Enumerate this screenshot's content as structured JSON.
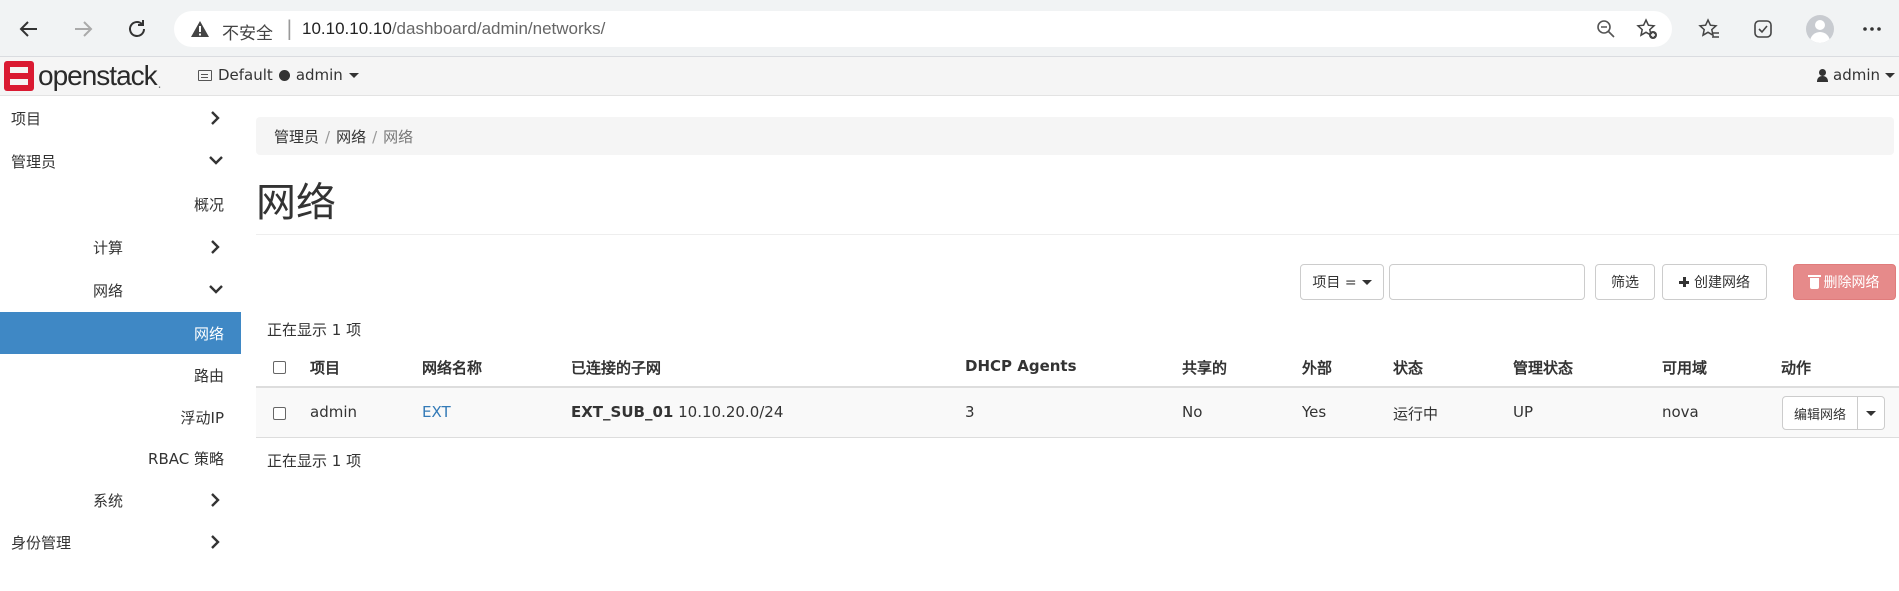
{
  "browser": {
    "insecure_label": "不安全",
    "url_host": "10.10.10.10",
    "url_path": "/dashboard/admin/networks/"
  },
  "topnav": {
    "brand": "openstack",
    "brand_suffix": ".",
    "domain": "Default",
    "project": "admin",
    "user": "admin"
  },
  "sidebar": {
    "items": [
      {
        "label": "项目",
        "icon": "chevron-right-icon"
      },
      {
        "label": "管理员",
        "icon": "chevron-down-icon"
      },
      {
        "label": "概况"
      },
      {
        "label": "计算",
        "icon": "chevron-right-icon"
      },
      {
        "label": "网络",
        "icon": "chevron-down-icon"
      },
      {
        "label": "网络",
        "active": true
      },
      {
        "label": "路由"
      },
      {
        "label": "浮动IP"
      },
      {
        "label": "RBAC 策略"
      },
      {
        "label": "系统",
        "icon": "chevron-right-icon"
      },
      {
        "label": "身份管理",
        "icon": "chevron-right-icon"
      }
    ],
    "active_color": "#3f88c5"
  },
  "breadcrumb": [
    "管理员",
    "网络",
    "网络"
  ],
  "page_title": "网络",
  "toolbar": {
    "filter_field": "项目 =",
    "search_value": "",
    "filter_button": "筛选",
    "create_button": "创建网络",
    "delete_button": "删除网络"
  },
  "count_top": "正在显示 1 项",
  "count_bottom": "正在显示 1 项",
  "table": {
    "headers": [
      "项目",
      "网络名称",
      "已连接的子网",
      "DHCP Agents",
      "共享的",
      "外部",
      "状态",
      "管理状态",
      "可用域",
      "动作"
    ],
    "rows": [
      {
        "project": "admin",
        "name": "EXT",
        "subnet_name": "EXT_SUB_01",
        "subnet_cidr": "10.10.20.0/24",
        "dhcp_agents": "3",
        "shared": "No",
        "external": "Yes",
        "status": "运行中",
        "admin_state": "UP",
        "availability_zone": "nova",
        "action": "编辑网络"
      }
    ]
  },
  "colors": {
    "link": "#337ab7",
    "danger_button": "#e68a8a",
    "brand_red": "#da1a32"
  }
}
